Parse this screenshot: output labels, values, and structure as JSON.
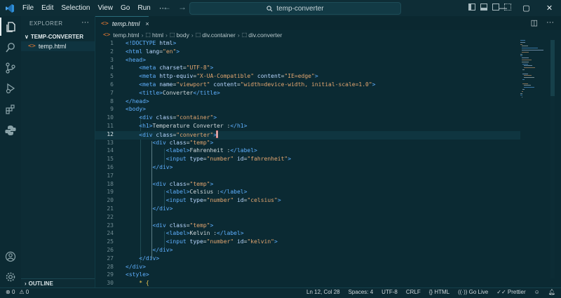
{
  "titlebar": {
    "menu": [
      "File",
      "Edit",
      "Selection",
      "View",
      "Go",
      "Run"
    ],
    "more": "···",
    "command_center": "temp-converter"
  },
  "sidebar": {
    "title": "EXPLORER",
    "dots": "···",
    "folder": "TEMP-CONVERTER",
    "file": "temp.html",
    "outline": "OUTLINE"
  },
  "tab": {
    "label": "temp.html",
    "close": "×"
  },
  "breadcrumb": {
    "file": "temp.html",
    "items": [
      "html",
      "body",
      "div.container",
      "div.converter"
    ]
  },
  "editor": {
    "current_line": 12,
    "lines": [
      {
        "n": 1,
        "html": "<span class='t'>&lt;!DOCTYPE</span> <span class='a'>html</span><span class='t'>&gt;</span>"
      },
      {
        "n": 2,
        "html": "<span class='t'>&lt;html</span> <span class='a'>lang</span>=<span class='s'>\"en\"</span><span class='t'>&gt;</span>"
      },
      {
        "n": 3,
        "html": "<span class='t'>&lt;head&gt;</span>"
      },
      {
        "n": 4,
        "html": "    <span class='t'>&lt;meta</span> <span class='a'>charset</span>=<span class='s'>\"UTF-8\"</span><span class='t'>&gt;</span>"
      },
      {
        "n": 5,
        "html": "    <span class='t'>&lt;meta</span> <span class='a'>http-equiv</span>=<span class='s'>\"X-UA-Compatible\"</span> <span class='a'>content</span>=<span class='s'>\"IE=edge\"</span><span class='t'>&gt;</span>"
      },
      {
        "n": 6,
        "html": "    <span class='t'>&lt;meta</span> <span class='a'>name</span>=<span class='s'>\"viewport\"</span> <span class='a'>content</span>=<span class='s'>\"width=device-width, initial-scale=1.0\"</span><span class='t'>&gt;</span>"
      },
      {
        "n": 7,
        "html": "    <span class='t'>&lt;title&gt;</span>Converter<span class='t'>&lt;/title&gt;</span>"
      },
      {
        "n": 8,
        "html": "<span class='t'>&lt;/head&gt;</span>"
      },
      {
        "n": 9,
        "html": "<span class='t'>&lt;body&gt;</span>"
      },
      {
        "n": 10,
        "html": "    <span class='t'>&lt;div</span> <span class='a'>class</span>=<span class='s'>\"container\"</span><span class='t'>&gt;</span>"
      },
      {
        "n": 11,
        "html": "    <span class='t'>&lt;h1&gt;</span>Temperature Converter :<span class='t'>&lt;/h1&gt;</span>"
      },
      {
        "n": 12,
        "html": "    <span class='t'>&lt;div</span> <span class='a'>class</span>=<span class='s'>\"converter\"</span><span class='t'>&gt;</span><span class='cursor'></span>"
      },
      {
        "n": 13,
        "html": "        <span class='t'>&lt;div</span> <span class='a'>class</span>=<span class='s'>\"temp\"</span><span class='t'>&gt;</span>"
      },
      {
        "n": 14,
        "html": "            <span class='t'>&lt;label&gt;</span>Fahrenheit :<span class='t'>&lt;/label&gt;</span>"
      },
      {
        "n": 15,
        "html": "            <span class='t'>&lt;input</span> <span class='a'>type</span>=<span class='s'>\"number\"</span> <span class='a'>id</span>=<span class='s'>\"fahrenheit\"</span><span class='t'>&gt;</span>"
      },
      {
        "n": 16,
        "html": "        <span class='t'>&lt;/div&gt;</span>"
      },
      {
        "n": 17,
        "html": ""
      },
      {
        "n": 18,
        "html": "        <span class='t'>&lt;div</span> <span class='a'>class</span>=<span class='s'>\"temp\"</span><span class='t'>&gt;</span>"
      },
      {
        "n": 19,
        "html": "            <span class='t'>&lt;label&gt;</span>Celsius :<span class='t'>&lt;/label&gt;</span>"
      },
      {
        "n": 20,
        "html": "            <span class='t'>&lt;input</span> <span class='a'>type</span>=<span class='s'>\"number\"</span> <span class='a'>id</span>=<span class='s'>\"celsius\"</span><span class='t'>&gt;</span>"
      },
      {
        "n": 21,
        "html": "        <span class='t'>&lt;/div&gt;</span>"
      },
      {
        "n": 22,
        "html": ""
      },
      {
        "n": 23,
        "html": "        <span class='t'>&lt;div</span> <span class='a'>class</span>=<span class='s'>\"temp\"</span><span class='t'>&gt;</span>"
      },
      {
        "n": 24,
        "html": "            <span class='t'>&lt;label&gt;</span>Kelvin :<span class='t'>&lt;/label&gt;</span>"
      },
      {
        "n": 25,
        "html": "            <span class='t'>&lt;input</span> <span class='a'>type</span>=<span class='s'>\"number\"</span> <span class='a'>id</span>=<span class='s'>\"kelvin\"</span><span class='t'>&gt;</span>"
      },
      {
        "n": 26,
        "html": "        <span class='t'>&lt;/div&gt;</span>"
      },
      {
        "n": 27,
        "html": "    <span class='t'>&lt;/div&gt;</span>"
      },
      {
        "n": 28,
        "html": "<span class='t'>&lt;/div&gt;</span>"
      },
      {
        "n": 29,
        "html": "<span class='t'>&lt;style&gt;</span>"
      },
      {
        "n": 30,
        "html": "    <span class='p'>* {</span>"
      }
    ]
  },
  "statusbar": {
    "errors": "0",
    "warnings": "0",
    "position": "Ln 12, Col 28",
    "spaces": "Spaces: 4",
    "encoding": "UTF-8",
    "eol": "CRLF",
    "language": "HTML",
    "golive": "Go Live",
    "prettier": "Prettier"
  },
  "colors": {
    "tag": "#5fb0ff",
    "attr": "#b9d7ff",
    "string": "#e3a670",
    "accent": "#e37933"
  }
}
